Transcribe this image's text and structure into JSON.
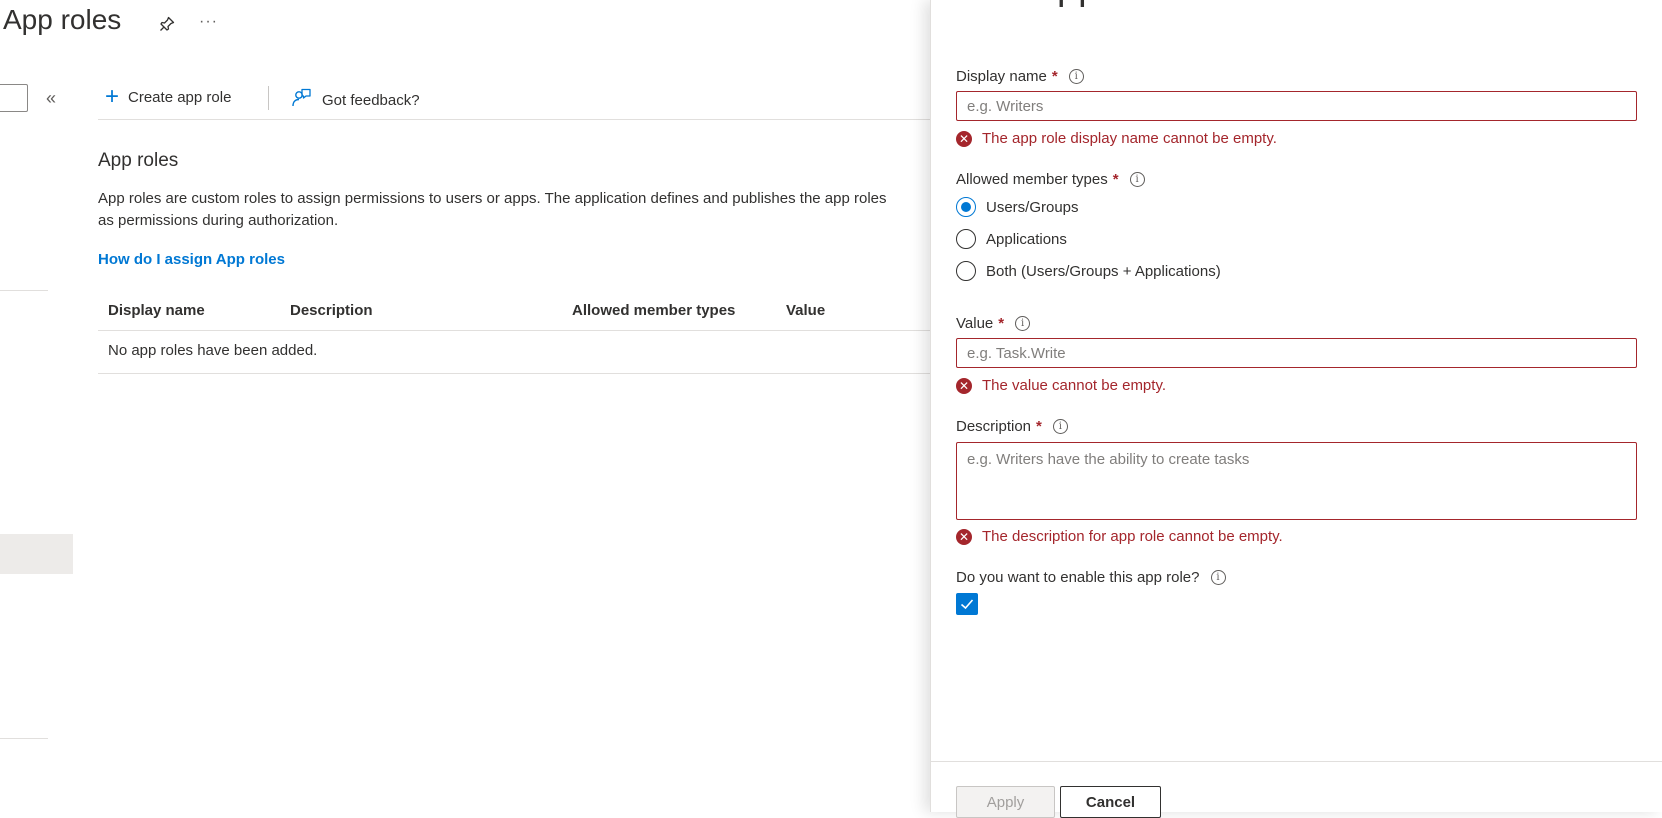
{
  "page": {
    "title": "App roles",
    "more": "···"
  },
  "commands": {
    "create_label": "Create app role",
    "feedback_label": "Got feedback?"
  },
  "section": {
    "title": "App roles",
    "description_line1": "App roles are custom roles to assign permissions to users or apps. The application defines and publishes the app roles",
    "description_line2": "as permissions during authorization.",
    "help_link": "How do I assign App roles"
  },
  "table": {
    "columns": [
      "Display name",
      "Description",
      "Allowed member types",
      "Value"
    ],
    "empty_message": "No app roles have been added."
  },
  "panel": {
    "header_fragment": "pp",
    "display_name": {
      "label": "Display name",
      "required": "*",
      "placeholder": "e.g. Writers",
      "error": "The app role display name cannot be empty."
    },
    "member_types": {
      "label": "Allowed member types",
      "required": "*",
      "options": [
        "Users/Groups",
        "Applications",
        "Both (Users/Groups + Applications)"
      ],
      "selected": "Users/Groups"
    },
    "value": {
      "label": "Value",
      "required": "*",
      "placeholder": "e.g. Task.Write",
      "error": "The value cannot be empty."
    },
    "description": {
      "label": "Description",
      "required": "*",
      "placeholder": "e.g. Writers have the ability to create tasks",
      "error": "The description for app role cannot be empty."
    },
    "enable": {
      "label": "Do you want to enable this app role?",
      "checked": true
    },
    "buttons": {
      "apply": "Apply",
      "cancel": "Cancel"
    }
  },
  "colors": {
    "accent": "#0078d4",
    "error": "#a4262c",
    "text": "#323130"
  }
}
